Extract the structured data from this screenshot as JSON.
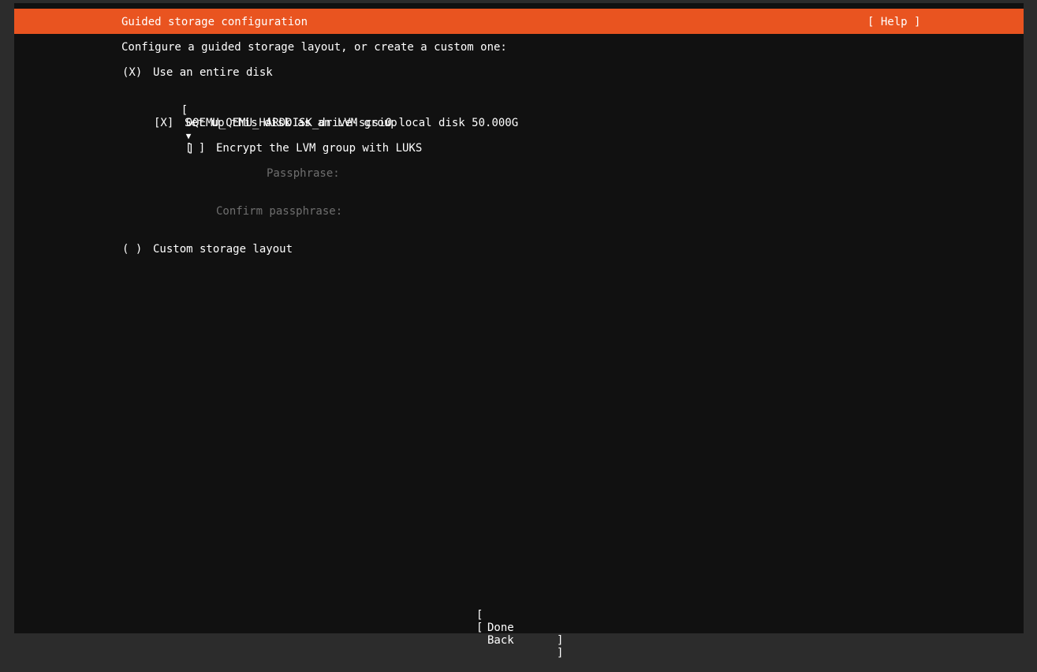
{
  "header": {
    "title": "Guided storage configuration",
    "help_label": "[ Help ]"
  },
  "intro": "Configure a guided storage layout, or create a custom one:",
  "entire_disk": {
    "marker": "(X)",
    "label": "Use an entire disk"
  },
  "disk_select": {
    "open": "[",
    "value": "0QEMU_QEMU_HARDDISK_drive-scsi0 local disk 50.000G",
    "arrow": "▼",
    "close": "]"
  },
  "lvm": {
    "marker": "[X]",
    "label": "Set up this disk as an LVM group"
  },
  "encrypt": {
    "marker": "[ ]",
    "label": "Encrypt the LVM group with LUKS"
  },
  "passphrase": {
    "label": "Passphrase:",
    "value": ""
  },
  "confirm_passphrase": {
    "label": "Confirm passphrase:",
    "value": ""
  },
  "custom": {
    "marker": "( )",
    "label": "Custom storage layout"
  },
  "buttons": {
    "done": {
      "open": "[",
      "label": "Done",
      "close": "]"
    },
    "back": {
      "open": "[",
      "label": "Back",
      "close": "]"
    }
  },
  "colors": {
    "accent": "#e95420",
    "background": "#111111",
    "frame": "#2c2c2c",
    "text": "#ffffff",
    "disabled_text": "#6f6f6f"
  }
}
